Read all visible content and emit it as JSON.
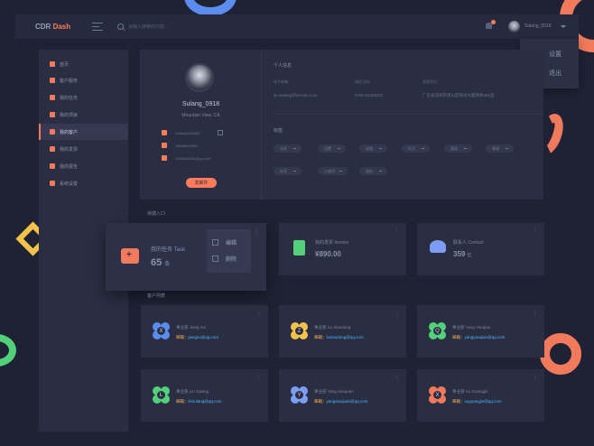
{
  "header": {
    "logo_main": "CDR ",
    "logo_accent": "Dash",
    "search_placeholder": "请输入搜索的内容...",
    "user_name": "Sulang_0918",
    "accent": "#ff7b5a"
  },
  "user_menu": {
    "settings": "设置",
    "logout": "退出"
  },
  "sidebar": {
    "items": [
      {
        "label": "首页",
        "icon": "home-icon",
        "color": "#f07a5b"
      },
      {
        "label": "客户服务",
        "icon": "service-icon",
        "color": "#f07a5b"
      },
      {
        "label": "我的任务",
        "icon": "task-icon",
        "color": "#f07a5b"
      },
      {
        "label": "我的项目",
        "icon": "project-icon",
        "color": "#f07a5b"
      },
      {
        "label": "我的客户",
        "icon": "customer-icon",
        "color": "#f07a5b",
        "active": true
      },
      {
        "label": "我的发票",
        "icon": "invoice-icon",
        "color": "#f07a5b"
      },
      {
        "label": "我的报告",
        "icon": "report-icon",
        "color": "#f07a5b"
      },
      {
        "label": "系统设置",
        "icon": "settings-icon",
        "color": "#f07a5b"
      }
    ]
  },
  "profile": {
    "name": "Sulang_0918",
    "location": "Mountain View, CA",
    "wechat": "Sulang0918887",
    "phone": "18648262688",
    "email": "1259486201@qq.com",
    "send_button": "发邮件"
  },
  "personal_info": {
    "title": "个人信息",
    "email_label": "电子邮箱：",
    "email_value": "lin.sulang@formatc.com",
    "phone_label": "电话号码：",
    "phone_value": "0755-81208102",
    "address_label": "家庭住址：",
    "address_value": "广东省深圳市南山区阳光大厦南桥305室"
  },
  "tags": {
    "title": "标签",
    "row1": [
      "派发",
      "设置",
      "滤镜",
      "标注",
      "渠道",
      "客服"
    ],
    "row2": [
      "标签",
      "二维码",
      "服务"
    ]
  },
  "quick_entry": {
    "title": "快捷入口",
    "task": {
      "title": "我的任务 Task",
      "value": "65",
      "unit": "条",
      "edit": "编辑",
      "delete": "删除"
    },
    "invoice": {
      "title": "我的发票 Invoice",
      "value": "¥890.00"
    },
    "contact": {
      "title": "联系人 Contact",
      "value": "359",
      "unit": "位"
    }
  },
  "customers": {
    "title": "客户列表",
    "mail_key": "邮箱：",
    "items": [
      {
        "initial": "X",
        "name": "事业部 Jiang XU",
        "email": "jiangxu@qq.com",
        "color": "#5b8dee"
      },
      {
        "initial": "Z",
        "name": "事业部 Zu Xiaodong",
        "email": "luxiaodong@qq.com",
        "color": "#f3c24a"
      },
      {
        "initial": "Q",
        "name": "事业部 Yang Yaoqiao",
        "email": "yangyaoqiao@qq.com",
        "color": "#52d07a"
      },
      {
        "initial": "L",
        "name": "事业部 Lin Sulang",
        "email": "linsulang@qq.com",
        "color": "#52d07a"
      },
      {
        "initial": "Y",
        "name": "事业部 Yang Xiaojuan",
        "email": "yangxiaojuan@qq.com",
        "color": "#7f9cf5"
      },
      {
        "initial": "X",
        "name": "事业部 Xu Guangjin",
        "email": "xuguangjin@qq.com",
        "color": "#f07a5b"
      }
    ]
  }
}
